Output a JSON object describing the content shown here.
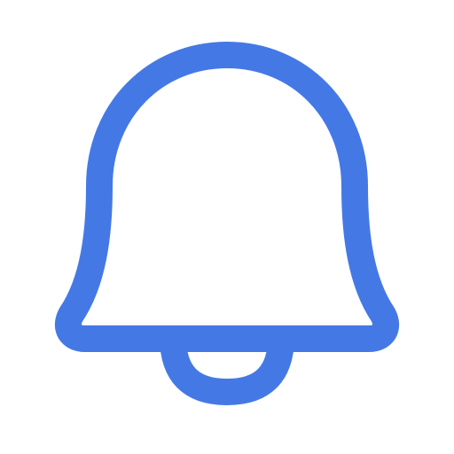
{
  "icon": {
    "name": "bell-icon",
    "stroke_color": "#4479E5",
    "fill_color": "#FFFFFF",
    "background": "#FFFFFF"
  }
}
